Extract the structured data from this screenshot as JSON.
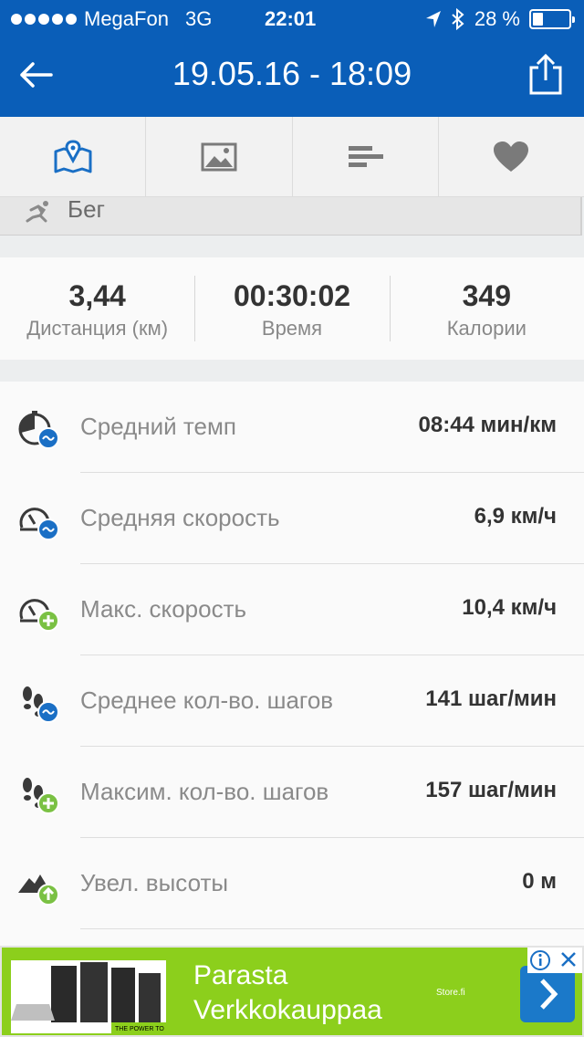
{
  "status_bar": {
    "carrier": "MegaFon",
    "network": "3G",
    "time": "22:01",
    "battery_text": "28 %",
    "battery_level": 0.28
  },
  "nav": {
    "title": "19.05.16 - 18:09"
  },
  "tabs": [
    {
      "icon": "map-icon",
      "active": true
    },
    {
      "icon": "image-icon",
      "active": false
    },
    {
      "icon": "list-icon",
      "active": false
    },
    {
      "icon": "heart-icon",
      "active": false
    }
  ],
  "activity": {
    "label": "Бег"
  },
  "summary": [
    {
      "value": "3,44",
      "caption": "Дистанция (км)"
    },
    {
      "value": "00:30:02",
      "caption": "Время"
    },
    {
      "value": "349",
      "caption": "Калории"
    }
  ],
  "stats": [
    {
      "label": "Средний темп",
      "value": "08:44 мин/км",
      "icon": "avg-pace-icon"
    },
    {
      "label": "Средняя скорость",
      "value": "6,9 км/ч",
      "icon": "avg-speed-icon"
    },
    {
      "label": "Макс. скорость",
      "value": "10,4 км/ч",
      "icon": "max-speed-icon"
    },
    {
      "label": "Среднее кол-во. шагов",
      "value": "141 шаг/мин",
      "icon": "avg-steps-icon"
    },
    {
      "label": "Максим. кол-во. шагов",
      "value": "157 шаг/мин",
      "icon": "max-steps-icon"
    },
    {
      "label": "Увел. высоты",
      "value": "0 м",
      "icon": "elevation-gain-icon"
    }
  ],
  "ad": {
    "title_line1": "Parasta",
    "title_line2": "Verkkokauppaa",
    "brand": "Store.fi",
    "tagline": "THE POWER TO"
  },
  "colors": {
    "header": "#0a5eb8",
    "accent_blue": "#1a6fc5",
    "accent_green": "#7ac143",
    "ad_green": "#8ccf1c"
  }
}
